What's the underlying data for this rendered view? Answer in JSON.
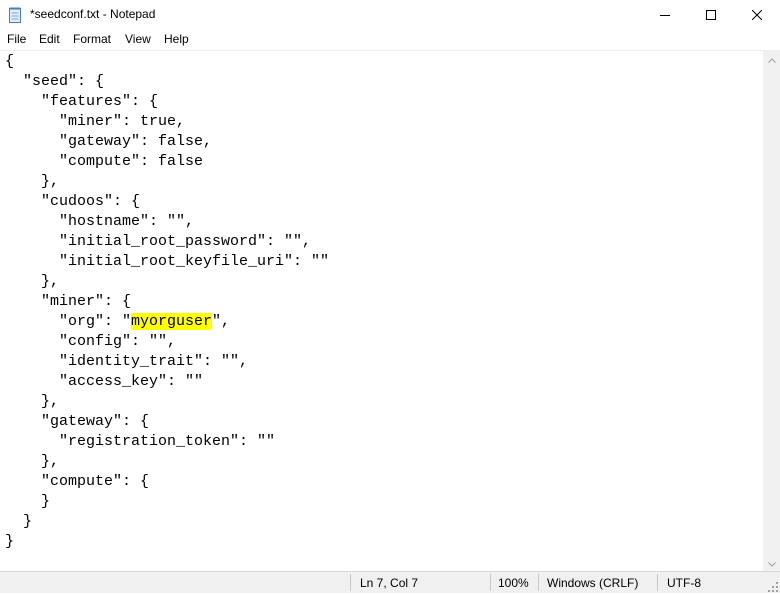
{
  "window": {
    "title": "*seedconf.txt - Notepad",
    "icon": "notepad-icon",
    "controls": [
      "minimize-icon",
      "maximize-icon",
      "close-icon"
    ]
  },
  "menu": {
    "file": "File",
    "edit": "Edit",
    "format": "Format",
    "view": "View",
    "help": "Help"
  },
  "editor": {
    "line_1": "{",
    "line_2": "  \"seed\": {",
    "line_3": "    \"features\": {",
    "line_4": "      \"miner\": true,",
    "line_5": "      \"gateway\": false,",
    "line_6": "      \"compute\": false",
    "line_7": "    },",
    "line_8": "    \"cudoos\": {",
    "line_9": "      \"hostname\": \"\",",
    "line_10": "      \"initial_root_password\": \"\",",
    "line_11": "      \"initial_root_keyfile_uri\": \"\"",
    "line_12": "    },",
    "line_13": "    \"miner\": {",
    "line_14_before": "      \"org\": \"",
    "line_14_selected": "myorguser",
    "line_14_after": "\",",
    "line_15": "      \"config\": \"\",",
    "line_16": "      \"identity_trait\": \"\",",
    "line_17": "      \"access_key\": \"\"",
    "line_18": "    },",
    "line_19": "    \"gateway\": {",
    "line_20": "      \"registration_token\": \"\"",
    "line_21": "    },",
    "line_22": "    \"compute\": {",
    "line_23": "    }",
    "line_24": "  }",
    "line_25": "}",
    "highlight_color": "#ffff00"
  },
  "statusbar": {
    "position": "Ln 7, Col 7",
    "zoom": "100%",
    "line_endings": "Windows (CRLF)",
    "encoding": "UTF-8"
  }
}
